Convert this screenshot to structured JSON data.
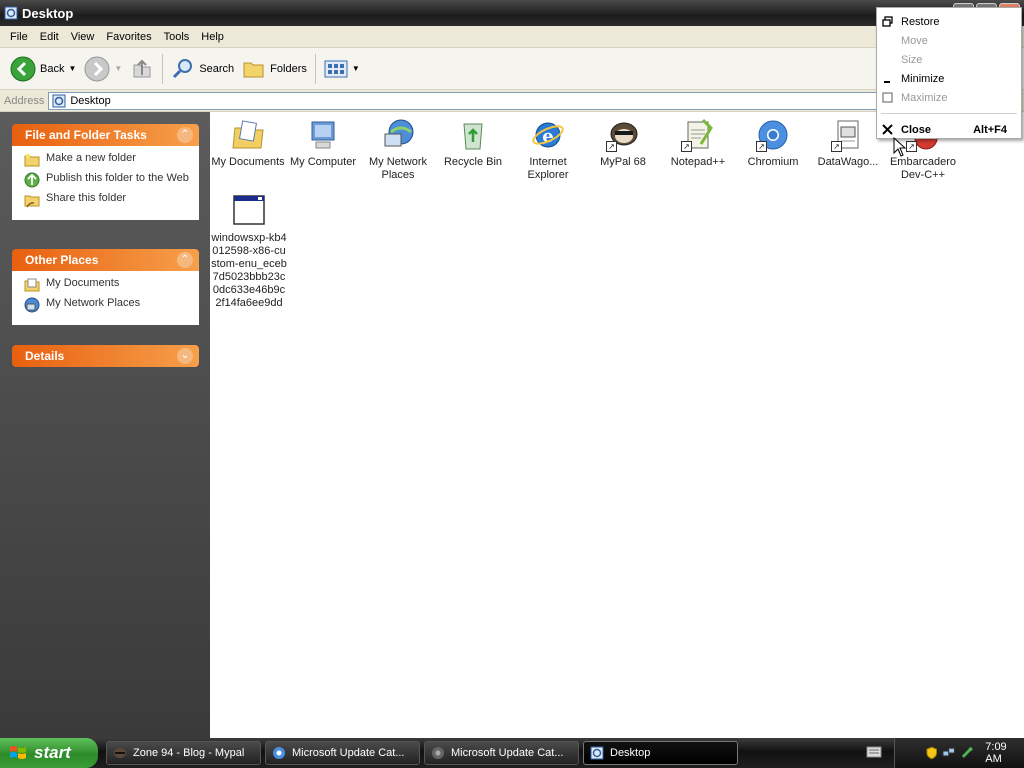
{
  "window": {
    "title": "Desktop"
  },
  "menubar": [
    "File",
    "Edit",
    "View",
    "Favorites",
    "Tools",
    "Help"
  ],
  "toolbar": {
    "back": "Back",
    "search": "Search",
    "folders": "Folders"
  },
  "address": {
    "label": "Address",
    "value": "Desktop"
  },
  "panels": {
    "file_tasks": {
      "title": "File and Folder Tasks",
      "items": [
        "Make a new folder",
        "Publish this folder to the Web",
        "Share this folder"
      ]
    },
    "other_places": {
      "title": "Other Places",
      "items": [
        "My Documents",
        "My Network Places"
      ]
    },
    "details": {
      "title": "Details"
    }
  },
  "icons": [
    {
      "name": "My Documents"
    },
    {
      "name": "My Computer"
    },
    {
      "name": "My Network Places"
    },
    {
      "name": "Recycle Bin"
    },
    {
      "name": "Internet Explorer"
    },
    {
      "name": "MyPal 68"
    },
    {
      "name": "Notepad++"
    },
    {
      "name": "Chromium"
    },
    {
      "name": "DataWago..."
    },
    {
      "name": "Embarcadero Dev-C++"
    },
    {
      "name": "windowsxp-kb4012598-x86-custom-enu_eceb7d5023bbb23c0dc633e46b9c2f14fa6ee9dd"
    }
  ],
  "context_menu": {
    "items": [
      {
        "label": "Restore",
        "enabled": true
      },
      {
        "label": "Move",
        "enabled": false
      },
      {
        "label": "Size",
        "enabled": false
      },
      {
        "label": "Minimize",
        "enabled": true
      },
      {
        "label": "Maximize",
        "enabled": false
      },
      {
        "label": "Close",
        "enabled": true,
        "accel": "Alt+F4"
      }
    ]
  },
  "taskbar": {
    "start": "start",
    "tasks": [
      "Zone 94 - Blog - Mypal",
      "Microsoft Update Cat...",
      "Microsoft Update Cat...",
      "Desktop"
    ],
    "clock": "7:09 AM"
  }
}
